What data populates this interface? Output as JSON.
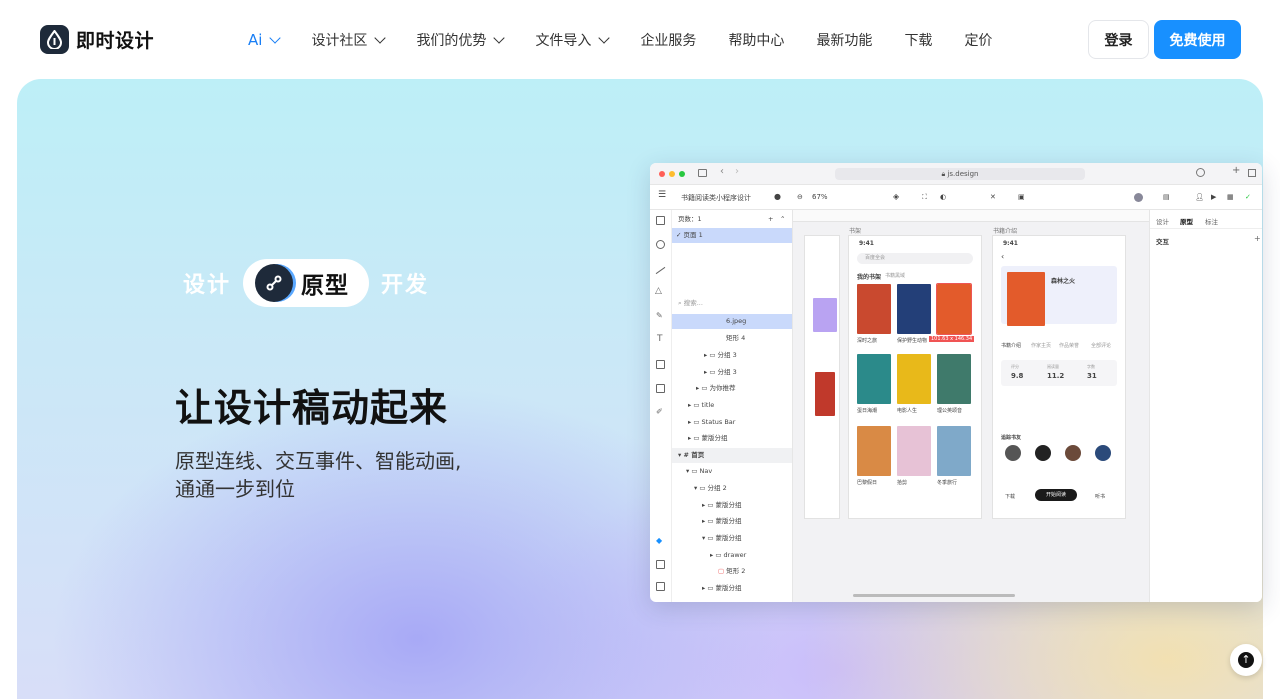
{
  "brand": {
    "name": "即时设计"
  },
  "nav": {
    "items": [
      {
        "label": "Ai",
        "dropdown": true
      },
      {
        "label": "设计社区",
        "dropdown": true
      },
      {
        "label": "我们的优势",
        "dropdown": true
      },
      {
        "label": "文件导入",
        "dropdown": true
      },
      {
        "label": "企业服务",
        "dropdown": false
      },
      {
        "label": "帮助中心",
        "dropdown": false
      },
      {
        "label": "最新功能",
        "dropdown": false
      },
      {
        "label": "下载",
        "dropdown": false
      },
      {
        "label": "定价",
        "dropdown": false
      }
    ],
    "login_label": "登录",
    "free_label": "免费使用"
  },
  "hero": {
    "tag_left": "设计",
    "tag_mid": "原型",
    "tag_right": "开发",
    "headline": "让设计稿动起来",
    "subline": "原型连线、交互事件、智能动画,通通一步到位"
  },
  "app": {
    "url": "js.design",
    "file_name": "书籍阅读类小程序设计",
    "zoom": "67%",
    "pages_label": "页数：1",
    "page_name": "页面 1",
    "search_placeholder": "搜索...",
    "layers": [
      "6.jpeg",
      "矩形 4",
      "分组 3",
      "分组 3",
      "为你推荐",
      "title",
      "Status Bar",
      "蒙版分组",
      "首页",
      "Nav",
      "分组 2",
      "蒙版分组",
      "蒙版分组",
      "蒙版分组",
      "drawer",
      "矩形 2",
      "蒙版分组"
    ],
    "right_tabs": [
      "设计",
      "原型",
      "标注"
    ],
    "right_section": "交互",
    "frame_labels": [
      "书架",
      "书籍介绍"
    ],
    "phone_time": "9:41",
    "search_hint": "百度全会",
    "shelf_tabs": [
      "我的书架",
      "书籍黑域"
    ],
    "books": [
      "深时之旅",
      "保护野生动物",
      "森林之火",
      "蛋日海潮",
      "电影人生",
      "理公英颂音",
      "巴黎假日",
      "拾剪",
      "冬季旅行"
    ],
    "size_badge": "101.63 x 146.34",
    "detail": {
      "title": "森林之火",
      "tabs": [
        "书籍介绍",
        "作家主页",
        "作品荣誉",
        "全部评论"
      ],
      "stats": [
        {
          "label": "评分",
          "value": "9.8"
        },
        {
          "label": "阅读量",
          "value": "11.2"
        },
        {
          "label": "字数",
          "value": "31"
        }
      ],
      "section": "追踪书友",
      "cta": "开始阅读",
      "actions": [
        "下载",
        "听书"
      ]
    },
    "colors": {
      "accent": "#1890ff",
      "selection": "#c9d9fb"
    }
  }
}
